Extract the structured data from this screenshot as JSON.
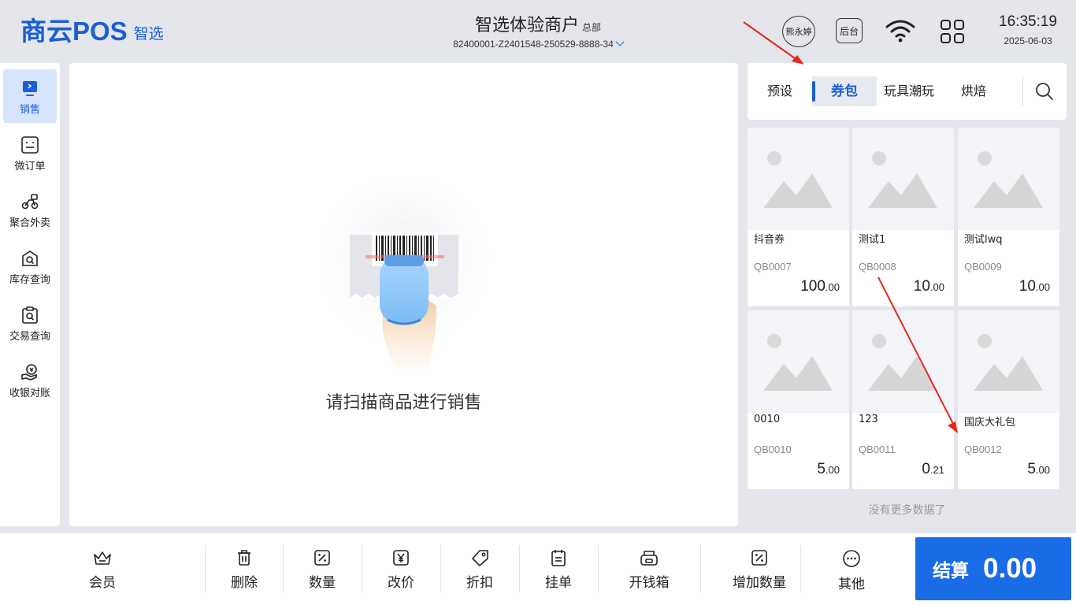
{
  "header": {
    "logo_main": "商云POS",
    "logo_sub": "智选",
    "merchant_name": "智选体验商户",
    "merchant_tag": "总部",
    "merchant_code": "82400001-Z2401548-250529-8888-34",
    "user_name": "熊永婷",
    "backend_label": "后台",
    "time": "16:35:19",
    "date": "2025-06-03"
  },
  "sidebar": {
    "items": [
      {
        "label": "销售",
        "icon": "sales-icon"
      },
      {
        "label": "微订单",
        "icon": "micro-order-icon"
      },
      {
        "label": "聚合外卖",
        "icon": "delivery-icon"
      },
      {
        "label": "库存查询",
        "icon": "inventory-icon"
      },
      {
        "label": "交易查询",
        "icon": "transaction-icon"
      },
      {
        "label": "收银对账",
        "icon": "reconcile-icon"
      }
    ]
  },
  "main": {
    "scan_prompt": "请扫描商品进行销售"
  },
  "categories": {
    "tabs": [
      {
        "label": "预设"
      },
      {
        "label": "券包"
      },
      {
        "label": "玩具潮玩"
      },
      {
        "label": "烘焙"
      }
    ],
    "active": "券包"
  },
  "products": [
    {
      "name": "抖音券",
      "code": "QB0007",
      "price_int": "100",
      "price_dec": ".00"
    },
    {
      "name": "测试1",
      "code": "QB0008",
      "price_int": "10",
      "price_dec": ".00"
    },
    {
      "name": "测试lwq",
      "code": "QB0009",
      "price_int": "10",
      "price_dec": ".00"
    },
    {
      "name": "0010",
      "code": "QB0010",
      "price_int": "5",
      "price_dec": ".00"
    },
    {
      "name": "123",
      "code": "QB0011",
      "price_int": "0",
      "price_dec": ".21"
    },
    {
      "name": "国庆大礼包",
      "code": "QB0012",
      "price_int": "5",
      "price_dec": ".00"
    }
  ],
  "no_more_text": "没有更多数据了",
  "footer": {
    "buttons": [
      {
        "label": "会员",
        "icon": "crown-icon"
      },
      {
        "label": "删除",
        "icon": "trash-icon"
      },
      {
        "label": "数量",
        "icon": "percent-box-icon"
      },
      {
        "label": "改价",
        "icon": "yen-box-icon"
      },
      {
        "label": "折扣",
        "icon": "tag-icon"
      },
      {
        "label": "挂单",
        "icon": "clipboard-icon"
      },
      {
        "label": "开钱箱",
        "icon": "cash-drawer-icon"
      },
      {
        "label": "增加数量",
        "icon": "percent-box-icon"
      },
      {
        "label": "其他",
        "icon": "more-icon"
      }
    ],
    "checkout_label": "结算",
    "checkout_total": "0.00"
  },
  "colors": {
    "accent": "#1a5fd6",
    "checkout": "#1a6ce6",
    "annotation_arrow": "#e8261e"
  }
}
